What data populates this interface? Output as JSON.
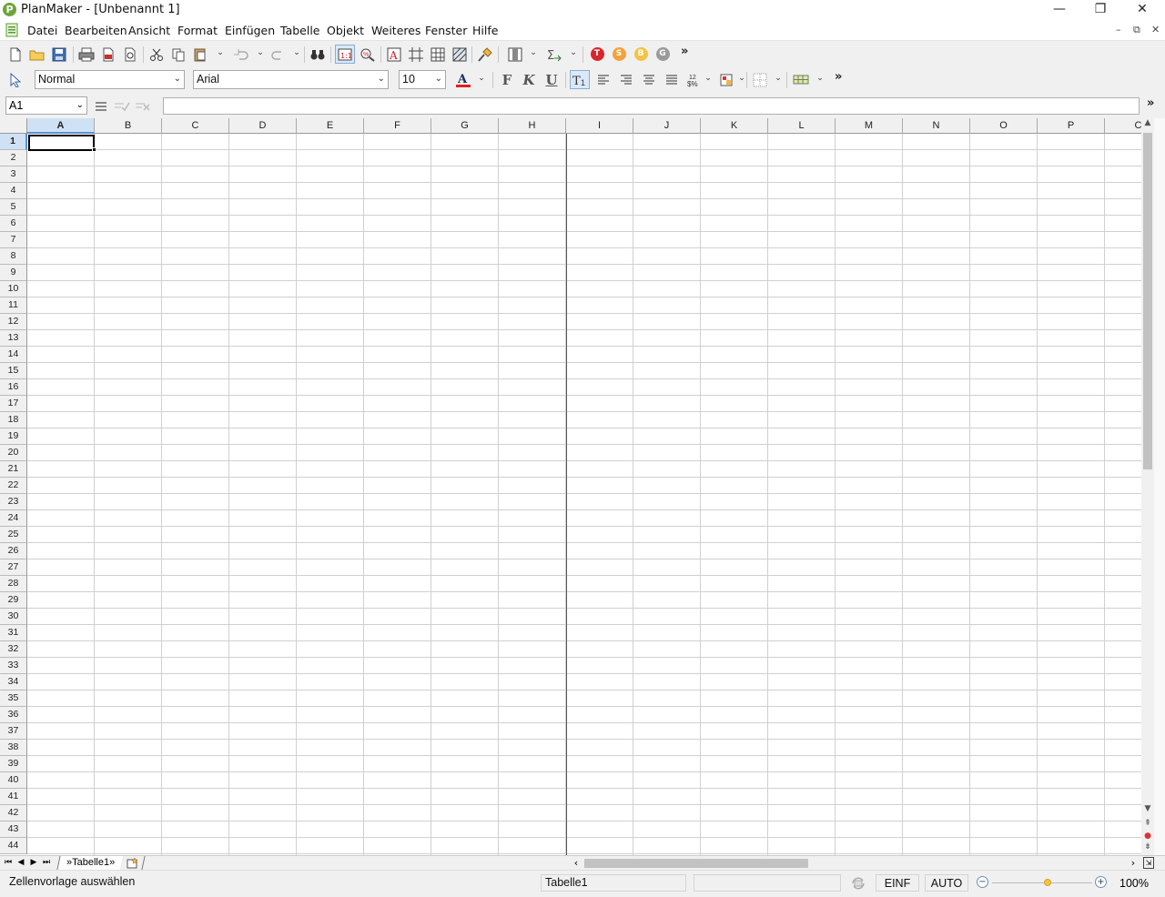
{
  "window": {
    "title": "PlanMaker - [Unbenannt 1]",
    "logo_letter": "P",
    "minimize": "—",
    "restore": "❐",
    "close": "✕"
  },
  "menu": {
    "items": [
      "Datei",
      "Bearbeiten",
      "Ansicht",
      "Format",
      "Einfügen",
      "Tabelle",
      "Objekt",
      "Weiteres",
      "Fenster",
      "Hilfe"
    ],
    "mdi": [
      "–",
      "⧉",
      "✕"
    ]
  },
  "toolbar": {
    "more": "»",
    "circle_buttons": [
      {
        "letter": "T",
        "color": "#d9262b"
      },
      {
        "letter": "S",
        "color": "#f2a23a"
      },
      {
        "letter": "B",
        "color": "#f5c242"
      },
      {
        "letter": "G",
        "color": "#9a9a9a"
      }
    ]
  },
  "format_bar": {
    "style_value": "Normal",
    "font_value": "Arial",
    "size_value": "10",
    "bold": "F",
    "italic": "K",
    "underline": "U",
    "font_color": "#e02020",
    "more": "»",
    "numfmt_top": "12",
    "numfmt_bottom": "$%"
  },
  "formula_bar": {
    "cell_ref": "A1",
    "formula": "",
    "more": "»"
  },
  "grid": {
    "columns": [
      "A",
      "B",
      "C",
      "D",
      "E",
      "F",
      "G",
      "H",
      "I",
      "J",
      "K",
      "L",
      "M",
      "N",
      "O",
      "P",
      "C"
    ],
    "rows": [
      "1",
      "2",
      "3",
      "4",
      "5",
      "6",
      "7",
      "8",
      "9",
      "10",
      "11",
      "12",
      "13",
      "14",
      "15",
      "16",
      "17",
      "18",
      "19",
      "20",
      "21",
      "22",
      "23",
      "24",
      "25",
      "26",
      "27",
      "28",
      "29",
      "30",
      "31",
      "32",
      "33",
      "34",
      "35",
      "36",
      "37",
      "38",
      "39",
      "40",
      "41",
      "42",
      "43",
      "44"
    ],
    "selected_column": "A",
    "selected_row": "1"
  },
  "sheets": {
    "tabs": [
      "»Tabelle1»"
    ],
    "nav": [
      "⏮",
      "◀",
      "▶",
      "⏭"
    ]
  },
  "status": {
    "hint": "Zellenvorlage auswählen",
    "sheet_name": "Tabelle1",
    "field3": "",
    "mode_insert": "EINF",
    "mode_calc": "AUTO",
    "zoom": "100%",
    "zoom_minus": "−",
    "zoom_plus": "+",
    "zoom_level": 0.55
  }
}
